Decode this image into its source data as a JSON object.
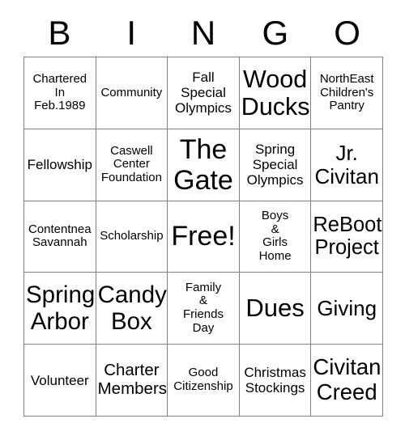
{
  "card": {
    "title": "Bingo Card",
    "header_letters": [
      "B",
      "I",
      "N",
      "G",
      "O"
    ],
    "columns": 5,
    "rows": 5,
    "grid_color": "#808080",
    "text_color": "#000000",
    "background_color": "#ffffff",
    "cells": [
      [
        {
          "text": "Chartered\nIn\nFeb.1989",
          "size": "sm",
          "free": false
        },
        {
          "text": "Community",
          "size": "sm",
          "free": false
        },
        {
          "text": "Fall\nSpecial\nOlympics",
          "size": "md",
          "free": false
        },
        {
          "text": "Wood\nDucks",
          "size": "xxl",
          "free": false
        },
        {
          "text": "NorthEast\nChildren's\nPantry",
          "size": "sm",
          "free": false
        }
      ],
      [
        {
          "text": "Fellowship",
          "size": "md",
          "free": false
        },
        {
          "text": "Caswell\nCenter\nFoundation",
          "size": "sm",
          "free": false
        },
        {
          "text": "The\nGate",
          "size": "huge",
          "free": false
        },
        {
          "text": "Spring\nSpecial\nOlympics",
          "size": "md",
          "free": false
        },
        {
          "text": "Jr.\nCivitan",
          "size": "xl",
          "free": false
        }
      ],
      [
        {
          "text": "Contentnea\nSavannah",
          "size": "sm",
          "free": false
        },
        {
          "text": "Scholarship",
          "size": "sm",
          "free": false
        },
        {
          "text": "Free!",
          "size": "huge",
          "free": true
        },
        {
          "text": "Boys\n&\nGirls\nHome",
          "size": "sm",
          "free": false
        },
        {
          "text": "ReBoot\nProject",
          "size": "xl",
          "free": false
        }
      ],
      [
        {
          "text": "Spring\nArbor",
          "size": "xxl",
          "free": false
        },
        {
          "text": "Candy\nBox",
          "size": "xxl",
          "free": false
        },
        {
          "text": "Family\n&\nFriends\nDay",
          "size": "sm",
          "free": false
        },
        {
          "text": "Dues",
          "size": "xxl",
          "free": false
        },
        {
          "text": "Giving",
          "size": "xl",
          "free": false
        }
      ],
      [
        {
          "text": "Volunteer",
          "size": "md",
          "free": false
        },
        {
          "text": "Charter\nMembers",
          "size": "lg",
          "free": false
        },
        {
          "text": "Good\nCitizenship",
          "size": "sm",
          "free": false
        },
        {
          "text": "Christmas\nStockings",
          "size": "md",
          "free": false
        },
        {
          "text": "Civitan\nCreed",
          "size": "xxl",
          "free": false
        }
      ]
    ]
  }
}
